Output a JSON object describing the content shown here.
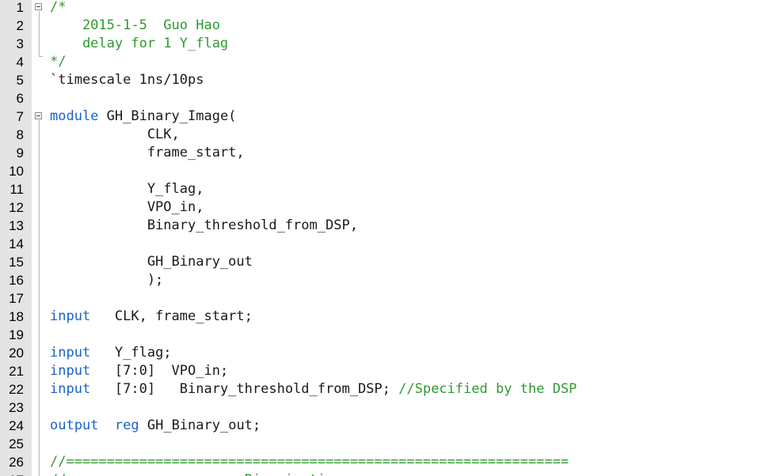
{
  "editor": {
    "language": "verilog",
    "colors": {
      "comment": "#2e9a2e",
      "keyword": "#1a63c8",
      "text": "#1a1a1a",
      "gutter": "#e4e4e4"
    },
    "lines": [
      {
        "num": "1",
        "tokens": [
          {
            "t": "/*",
            "c": "comment"
          }
        ]
      },
      {
        "num": "2",
        "tokens": [
          {
            "t": "    2015-1-5  Guo Hao",
            "c": "comment"
          }
        ]
      },
      {
        "num": "3",
        "tokens": [
          {
            "t": "    delay for 1 Y_flag",
            "c": "comment"
          }
        ]
      },
      {
        "num": "4",
        "tokens": [
          {
            "t": "*/",
            "c": "comment"
          }
        ]
      },
      {
        "num": "5",
        "tokens": [
          {
            "t": "`timescale 1ns/10ps",
            "c": "plain"
          }
        ]
      },
      {
        "num": "6",
        "tokens": []
      },
      {
        "num": "7",
        "tokens": [
          {
            "t": "module",
            "c": "keyword"
          },
          {
            "t": " GH_Binary_Image(",
            "c": "plain"
          }
        ]
      },
      {
        "num": "8",
        "tokens": [
          {
            "t": "            CLK,",
            "c": "plain"
          }
        ]
      },
      {
        "num": "9",
        "tokens": [
          {
            "t": "            frame_start,",
            "c": "plain"
          }
        ]
      },
      {
        "num": "10",
        "tokens": []
      },
      {
        "num": "11",
        "tokens": [
          {
            "t": "            Y_flag,",
            "c": "plain"
          }
        ]
      },
      {
        "num": "12",
        "tokens": [
          {
            "t": "            VPO_in,",
            "c": "plain"
          }
        ]
      },
      {
        "num": "13",
        "tokens": [
          {
            "t": "            Binary_threshold_from_DSP,",
            "c": "plain"
          }
        ]
      },
      {
        "num": "14",
        "tokens": []
      },
      {
        "num": "15",
        "tokens": [
          {
            "t": "            GH_Binary_out",
            "c": "plain"
          }
        ]
      },
      {
        "num": "16",
        "tokens": [
          {
            "t": "            );",
            "c": "plain"
          }
        ]
      },
      {
        "num": "17",
        "tokens": []
      },
      {
        "num": "18",
        "tokens": [
          {
            "t": "input",
            "c": "keyword"
          },
          {
            "t": "   CLK, frame_start;",
            "c": "plain"
          }
        ]
      },
      {
        "num": "19",
        "tokens": []
      },
      {
        "num": "20",
        "tokens": [
          {
            "t": "input",
            "c": "keyword"
          },
          {
            "t": "   Y_flag;",
            "c": "plain"
          }
        ]
      },
      {
        "num": "21",
        "tokens": [
          {
            "t": "input",
            "c": "keyword"
          },
          {
            "t": "   [7:0]  VPO_in;",
            "c": "plain"
          }
        ]
      },
      {
        "num": "22",
        "tokens": [
          {
            "t": "input",
            "c": "keyword"
          },
          {
            "t": "   [7:0]   Binary_threshold_from_DSP; ",
            "c": "plain"
          },
          {
            "t": "//Specified by the DSP",
            "c": "comment"
          }
        ]
      },
      {
        "num": "23",
        "tokens": []
      },
      {
        "num": "24",
        "tokens": [
          {
            "t": "output",
            "c": "keyword"
          },
          {
            "t": "  ",
            "c": "plain"
          },
          {
            "t": "reg",
            "c": "keyword"
          },
          {
            "t": " GH_Binary_out;",
            "c": "plain"
          }
        ]
      },
      {
        "num": "25",
        "tokens": []
      },
      {
        "num": "26",
        "tokens": [
          {
            "t": "//==============================================================",
            "c": "comment"
          }
        ]
      },
      {
        "num": "27",
        "tokens": [
          {
            "t": "//                      Binarization",
            "c": "comment"
          }
        ]
      }
    ]
  }
}
